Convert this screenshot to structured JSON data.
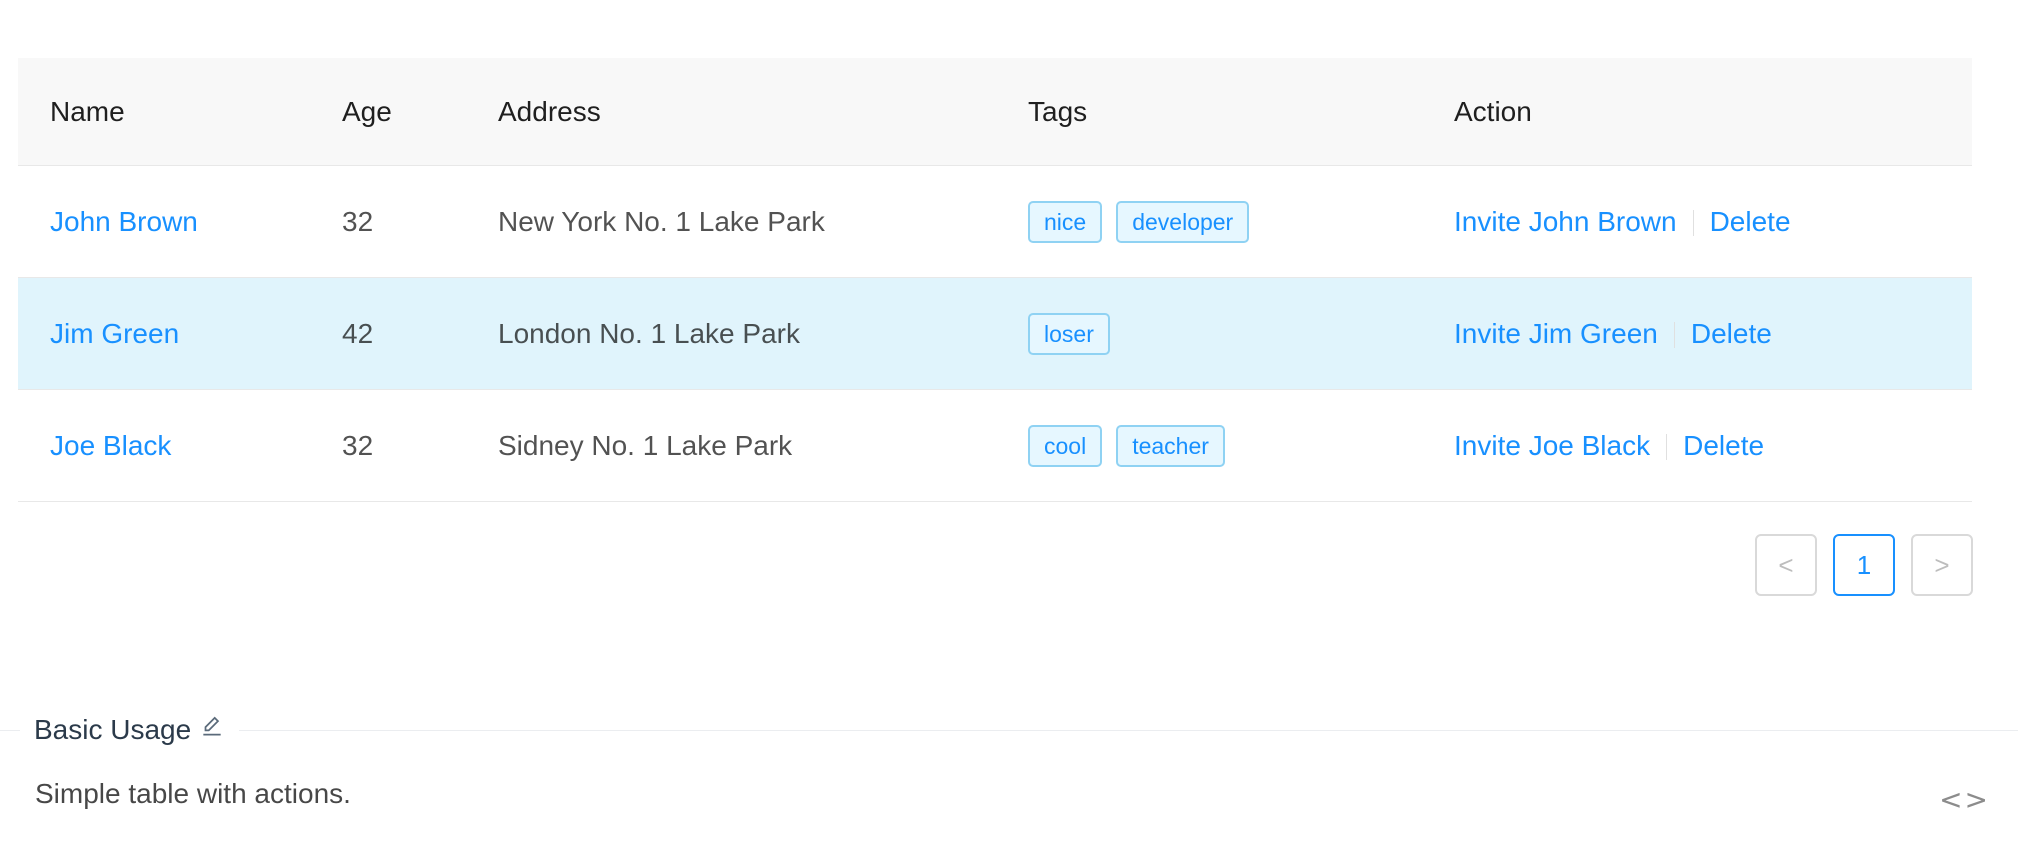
{
  "table": {
    "columns": [
      "Name",
      "Age",
      "Address",
      "Tags",
      "Action"
    ],
    "rows": [
      {
        "name": "John Brown",
        "age": "32",
        "address": "New York No. 1 Lake Park",
        "tags": [
          "nice",
          "developer"
        ],
        "invite": "Invite John Brown",
        "delete": "Delete"
      },
      {
        "name": "Jim Green",
        "age": "42",
        "address": "London No. 1 Lake Park",
        "tags": [
          "loser"
        ],
        "invite": "Invite Jim Green",
        "delete": "Delete"
      },
      {
        "name": "Joe Black",
        "age": "32",
        "address": "Sidney No. 1 Lake Park",
        "tags": [
          "cool",
          "teacher"
        ],
        "invite": "Invite Joe Black",
        "delete": "Delete"
      }
    ]
  },
  "pagination": {
    "prev": "<",
    "current": "1",
    "next": ">"
  },
  "demo": {
    "title": "Basic Usage",
    "description": "Simple table with actions.",
    "code_toggle": "<>"
  },
  "colors": {
    "link": "#1890ff",
    "row_hover": "#e0f4fc",
    "header_bg": "#f8f8f8"
  }
}
